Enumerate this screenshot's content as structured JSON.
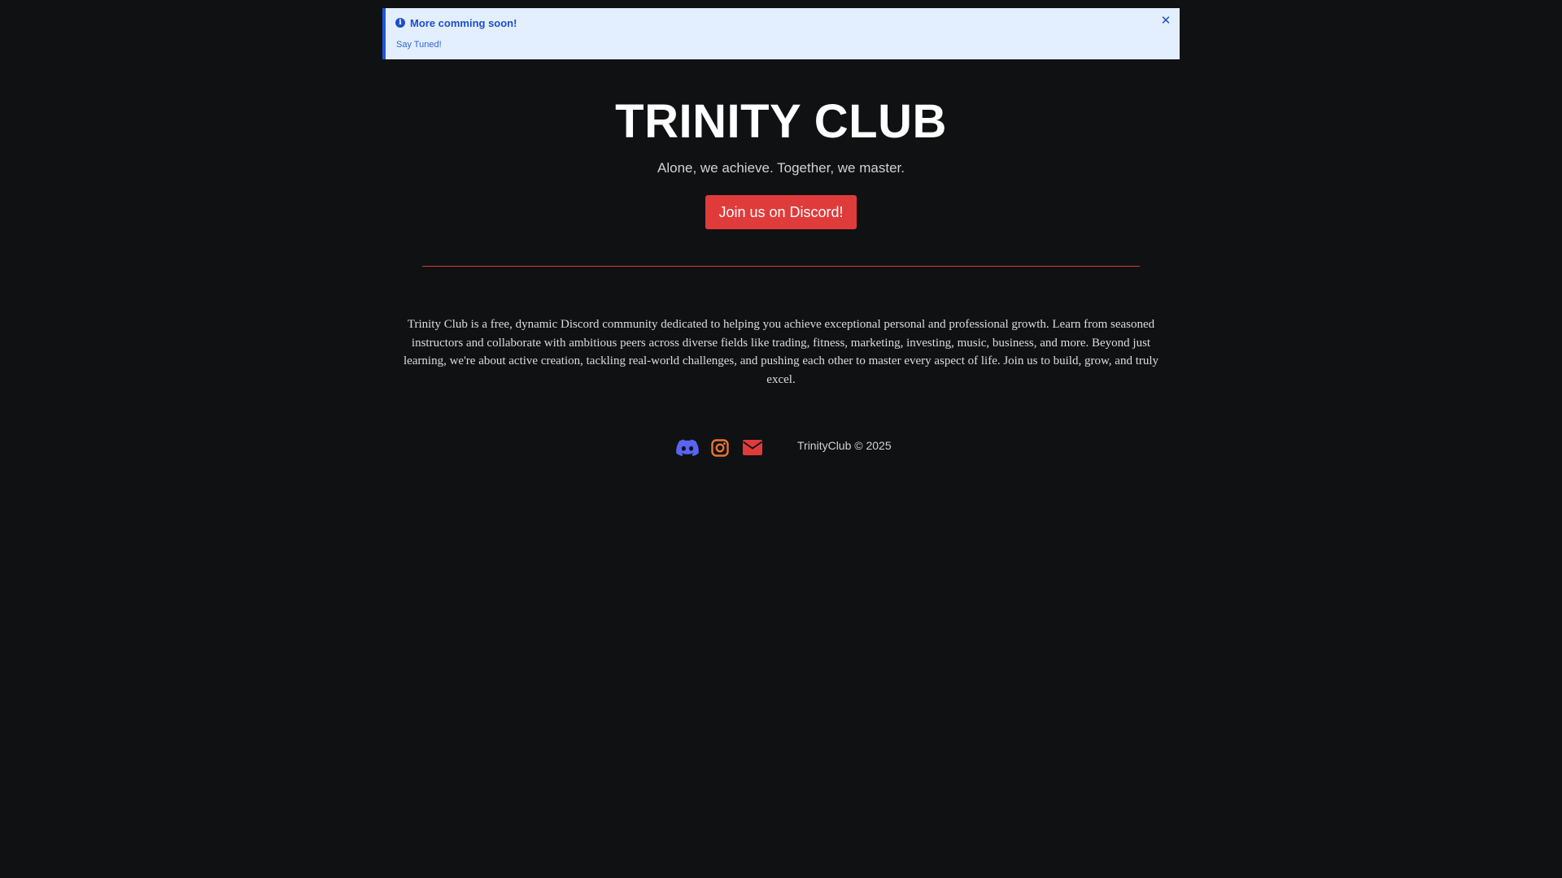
{
  "notice": {
    "title": "More comming soon!",
    "message": "Say Tuned!",
    "info_icon_glyph": "i",
    "close_glyph": "✕"
  },
  "hero": {
    "title": "TRINITY CLUB",
    "tagline": "Alone, we achieve. Together, we master.",
    "button_label": "Join us on Discord!"
  },
  "about": {
    "text": "Trinity Club is a free, dynamic Discord community dedicated to helping you achieve exceptional personal and professional growth. Learn from seasoned instructors and collaborate with ambitious peers across diverse fields like trading, fitness, marketing, investing, music, business, and more. Beyond just learning, we're about active creation, tackling real-world challenges, and pushing each other to master every aspect of life. Join us to build, grow, and truly excel."
  },
  "footer": {
    "social": [
      {
        "icon": "discord-icon",
        "color": "#5865f2"
      },
      {
        "icon": "instagram-icon",
        "color": "#e8742f"
      },
      {
        "icon": "envelope-icon",
        "color": "#e03b3b"
      }
    ],
    "copyright": "TrinityClub © 2025"
  },
  "colors": {
    "background": "#0f1113",
    "accent": "#e03b3b",
    "notice_background": "#e3efff",
    "notice_text": "#1d4fc7"
  }
}
